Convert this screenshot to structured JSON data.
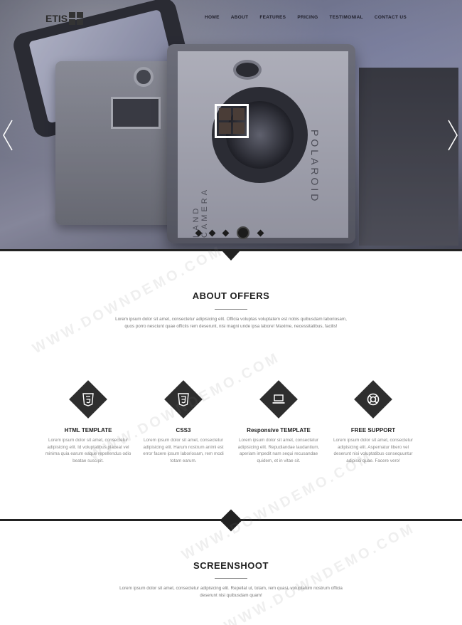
{
  "brand": {
    "logo_text": "ETIS"
  },
  "nav": {
    "items": [
      "HOME",
      "ABOUT",
      "FEATURES",
      "PRICING",
      "TESTIMONIAL",
      "CONTACT US"
    ]
  },
  "hero": {
    "camera_brand": "POLAROID",
    "camera_model": "LAND CAMERA",
    "slides_total": 5,
    "active_slide": 4
  },
  "about": {
    "title": "ABOUT OFFERS",
    "description": "Lorem ipsum dolor sit amet, consectetur adipisicing elit. Officia voluptas voluptatem est nobis quibusdam laboriosam, quos porro nesciunt quae officiis rem deserunt, nisi magni unde ipsa labore! Maxime, necessitatibus, facilis!"
  },
  "features": [
    {
      "icon": "html5-icon",
      "title": "HTML TEMPLATE",
      "text": "Lorem ipsum dolor sit amet, consectetur adipisicing elit. Id voluptatibus placeat vel minima quia earum eaque repellendus odio beatae suscipit."
    },
    {
      "icon": "css3-icon",
      "title": "CSS3",
      "text": "Lorem ipsum dolor sit amet, consectetur adipisicing elit. Harum nostrum animi est error facere ipsum laboriosam, rem modi totam earum."
    },
    {
      "icon": "laptop-icon",
      "title": "Responsive TEMPLATE",
      "text": "Lorem ipsum dolor sit amet, consectetur adipisicing elit. Repudiandae laudantium, aperiam impedit nam sequi recusandae quidem, et in vitae sit."
    },
    {
      "icon": "lifebuoy-icon",
      "title": "FREE SUPPORT",
      "text": "Lorem ipsum dolor sit amet, consectetur adipisicing elit. Aspernatur libero vel deserunt nisi voluptatibus consequuntur adipisci quae. Facere vero!"
    }
  ],
  "screenshots": {
    "title": "SCREENSHOOT",
    "description": "Lorem ipsum dolor sit amet, consectetur adipisicing elit. Repellat ut, totam, rem quasi, voluptatum nostrum officia deserunt nisi quibusdam quam!"
  },
  "watermark": "WWW.DOWNDEMO.COM"
}
